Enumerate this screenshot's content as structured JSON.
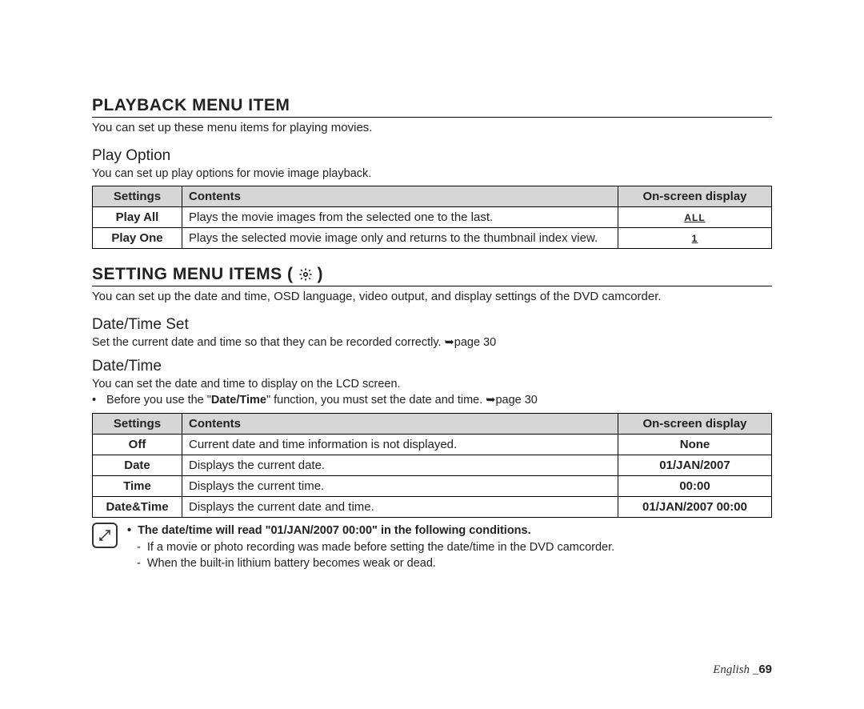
{
  "section1": {
    "heading": "PLAYBACK MENU ITEM",
    "intro": "You can set up these menu items for playing movies.",
    "sub1_heading": "Play Option",
    "sub1_desc": "You can set up play options for movie image playback.",
    "table_headers": {
      "settings": "Settings",
      "contents": "Contents",
      "osd": "On-screen display"
    },
    "rows": [
      {
        "settings": "Play All",
        "contents": "Plays the movie images from the selected one to the last.",
        "osd": "ALL"
      },
      {
        "settings": "Play One",
        "contents": "Plays the selected movie image only and returns to the thumbnail index view.",
        "osd": "1"
      }
    ]
  },
  "section2": {
    "heading": "SETTING MENU ITEMS (",
    "heading_close": ")",
    "intro": "You can set up the date and time, OSD language, video output, and display settings of the DVD camcorder.",
    "sub1_heading": "Date/Time Set",
    "sub1_desc": "Set the current date and time so that they can be recorded correctly. ➥page 30",
    "sub2_heading": "Date/Time",
    "sub2_desc": "You can set the date and time to display on the LCD screen.",
    "sub2_bullet_prefix": "Before you use the \"",
    "sub2_bullet_bold": "Date/Time",
    "sub2_bullet_suffix": "\" function, you must set the date and time. ➥page 30",
    "table_headers": {
      "settings": "Settings",
      "contents": "Contents",
      "osd": "On-screen display"
    },
    "rows": [
      {
        "settings": "Off",
        "contents": "Current date and time information is not displayed.",
        "osd": "None"
      },
      {
        "settings": "Date",
        "contents": "Displays the current date.",
        "osd": "01/JAN/2007"
      },
      {
        "settings": "Time",
        "contents": "Displays the current time.",
        "osd": "00:00"
      },
      {
        "settings": "Date&Time",
        "contents": "Displays the current date and time.",
        "osd": "01/JAN/2007 00:00"
      }
    ],
    "note": {
      "top": "The date/time will read \"01/JAN/2007 00:00\" in the following conditions.",
      "line1": "If a movie or photo recording was made before setting the date/time in the DVD camcorder.",
      "line2": "When the built-in lithium battery becomes weak or dead."
    }
  },
  "footer": {
    "lang": "English _",
    "page": "69"
  }
}
